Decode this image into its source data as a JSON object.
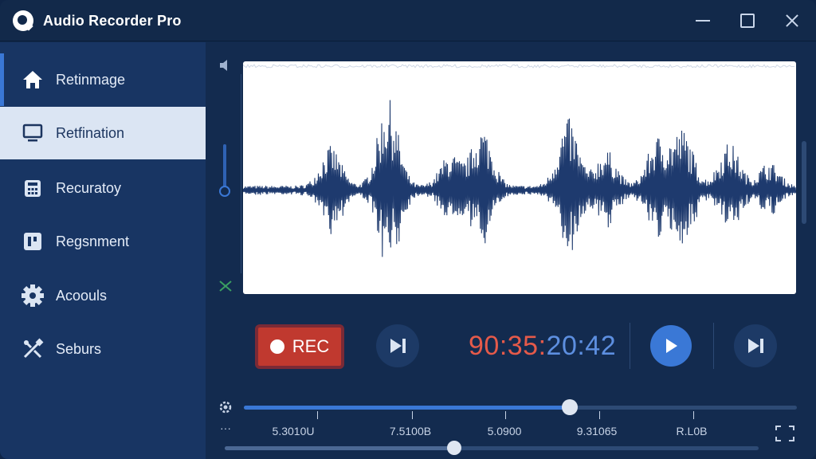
{
  "app": {
    "title": "Audio Recorder Pro"
  },
  "sidebar": {
    "items": [
      {
        "label": "Retinmage",
        "icon": "home-icon"
      },
      {
        "label": "Retfination",
        "icon": "monitor-icon"
      },
      {
        "label": "Recuratoy",
        "icon": "calculator-icon"
      },
      {
        "label": "Regsnment",
        "icon": "segment-icon"
      },
      {
        "label": "Acoouls",
        "icon": "gear-icon"
      },
      {
        "label": "Seburs",
        "icon": "tools-icon"
      }
    ],
    "selected_index": 1
  },
  "transport": {
    "rec_label": "REC",
    "timer_part1": "90:35:",
    "timer_part2": "20:42"
  },
  "timeline": {
    "progress": 0.59,
    "tick_labels": [
      "5.3010U",
      "7.5100B",
      "5.0900",
      "9.31065",
      "R.L0B"
    ],
    "scroll_position": 0.43
  },
  "colors": {
    "accent": "#3a78d6",
    "record": "#c0392f",
    "timer_red": "#e55a4a",
    "timer_blue": "#5d8fe0",
    "waveform": "#1e3a6e"
  }
}
